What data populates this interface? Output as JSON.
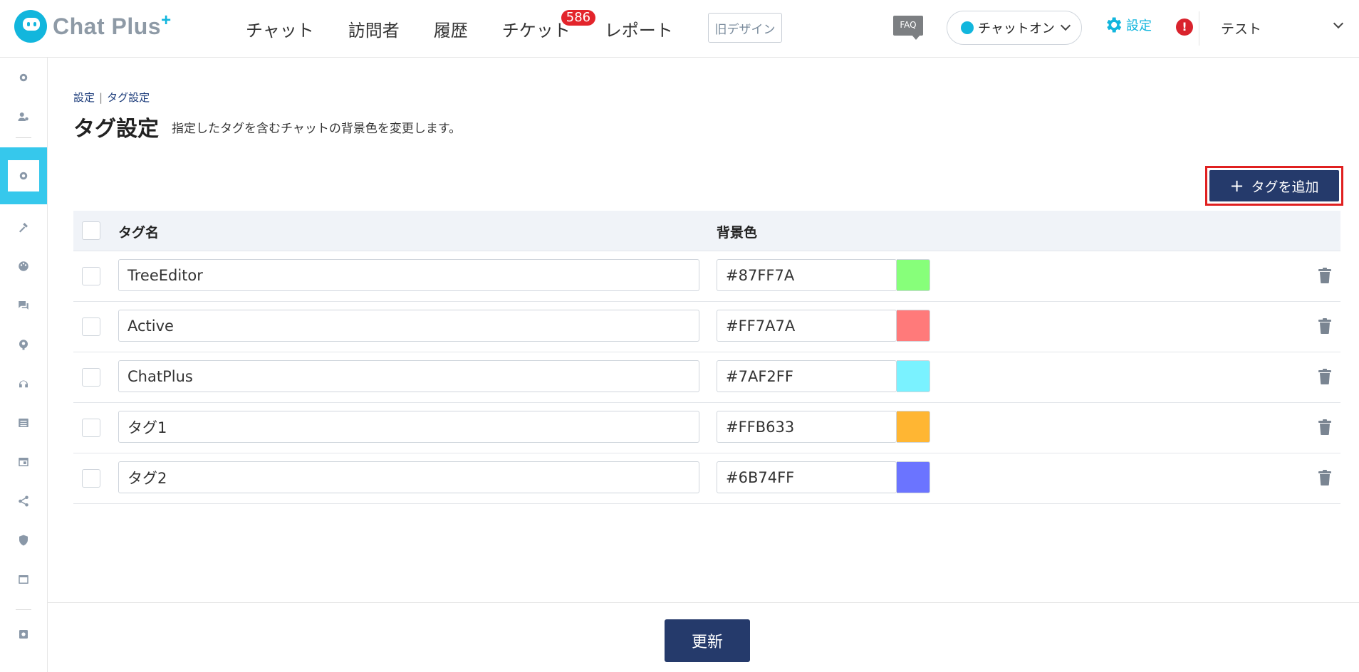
{
  "header": {
    "logo_text": "Chat Plus",
    "logo_plus": "+",
    "nav": [
      {
        "label": "チャット"
      },
      {
        "label": "訪問者"
      },
      {
        "label": "履歴"
      },
      {
        "label": "チケット",
        "badge": "586"
      },
      {
        "label": "レポート"
      }
    ],
    "old_design_label": "旧デザイン",
    "faq_label": "FAQ",
    "chat_status_label": "チャットオン",
    "chat_status_color": "#12b6dd",
    "settings_label": "設定",
    "alert_label": "!",
    "user_label": "テスト"
  },
  "sidebar": {
    "icons": [
      "gear-icon",
      "user-settings-icon",
      "tag-gear-icon",
      "tools-icon",
      "palette-icon",
      "chat-icon",
      "bot-icon",
      "headset-icon",
      "list-icon",
      "window-icon",
      "share-icon",
      "shield-icon",
      "browser-icon",
      "settings-small-icon"
    ],
    "active_index": 2
  },
  "breadcrumb": {
    "parent": "設定",
    "sep": "|",
    "current": "タグ設定"
  },
  "page": {
    "title": "タグ設定",
    "description": "指定したタグを含むチャットの背景色を変更します。",
    "add_button": "タグを追加",
    "update_button": "更新"
  },
  "table": {
    "headers": {
      "name": "タグ名",
      "color": "背景色"
    },
    "rows": [
      {
        "name": "TreeEditor",
        "color": "#87FF7A"
      },
      {
        "name": "Active",
        "color": "#FF7A7A"
      },
      {
        "name": "ChatPlus",
        "color": "#7AF2FF"
      },
      {
        "name": "タグ1",
        "color": "#FFB633"
      },
      {
        "name": "タグ2",
        "color": "#6B74FF"
      }
    ]
  },
  "colors": {
    "accent": "#12b6dd",
    "primary_button": "#253a6b",
    "badge": "#e3242b"
  }
}
